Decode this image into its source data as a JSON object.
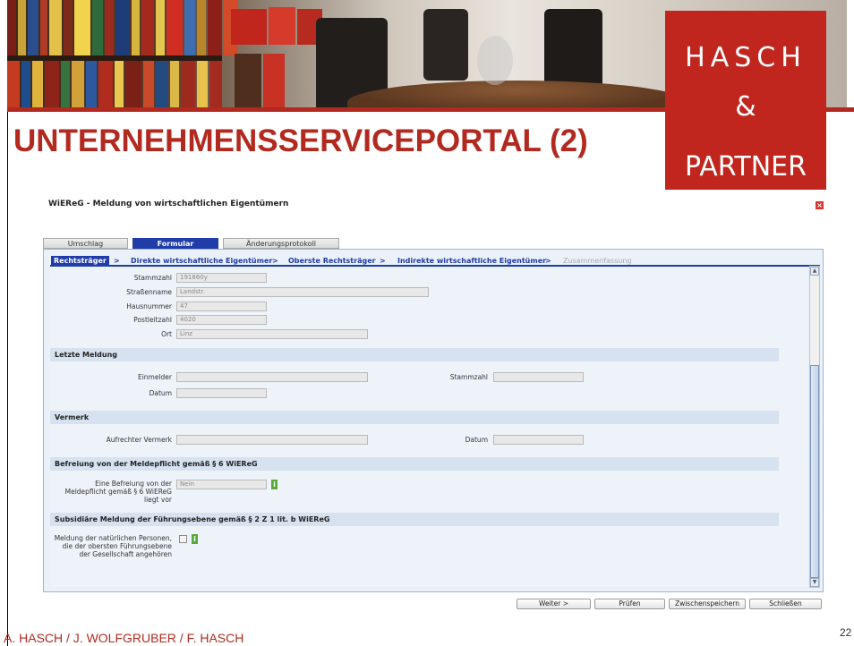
{
  "slide": {
    "title": "UNTERNEHMENSSERVICEPORTAL (2)",
    "footer": "A. HASCH / J. WOLFGRUBER / F. HASCH",
    "page_number": "22",
    "logo": {
      "line1": "HASCH",
      "line2": "&",
      "line3": "PARTNER"
    },
    "colors": {
      "brand_red": "#b22a1f",
      "nav_blue": "#1f3ca8"
    }
  },
  "app": {
    "title": "WiEReG - Meldung von wirtschaftlichen Eigentümern",
    "close_icon": "×",
    "tabs": [
      {
        "label": "Umschlag"
      },
      {
        "label": "Formular"
      },
      {
        "label": "Änderungsprotokoll"
      }
    ],
    "breadcrumb": [
      {
        "label": "Rechtsträger"
      },
      {
        "label": "Direkte wirtschaftliche Eigentümer"
      },
      {
        "label": "Oberste Rechtsträger"
      },
      {
        "label": "Indirekte wirtschaftliche Eigentümer"
      },
      {
        "label": "Zusammenfassung"
      }
    ],
    "breadcrumb_separator": ">",
    "address": {
      "stammzahl_label": "Stammzahl",
      "stammzahl_value": "191860y",
      "strassenname_label": "Straßenname",
      "strassenname_value": "Landstr.",
      "hausnummer_label": "Hausnummer",
      "hausnummer_value": "47",
      "postleitzahl_label": "Postleitzahl",
      "postleitzahl_value": "4020",
      "ort_label": "Ort",
      "ort_value": "Linz"
    },
    "letzte_meldung": {
      "heading": "Letzte Meldung",
      "einmelder_label": "Einmelder",
      "stammzahl_label": "Stammzahl",
      "datum_label": "Datum"
    },
    "vermerk": {
      "heading": "Vermerk",
      "aufrechter_label": "Aufrechter Vermerk",
      "datum_label": "Datum"
    },
    "befreiung": {
      "heading": "Befreiung von der Meldepflicht gemäß § 6 WiEReG",
      "label_line1": "Eine Befreiung von der",
      "label_line2": "Meldepflicht gemäß § 6 WiEReG",
      "label_line3": "liegt vor",
      "value": "Nein",
      "info_icon": "i"
    },
    "subsidiaer": {
      "heading": "Subsidiäre Meldung der Führungsebene gemäß § 2 Z 1 lit. b WiEReG",
      "label_line1": "Meldung der natürlichen Personen,",
      "label_line2": "die der obersten Führungsebene",
      "label_line3": "der Gesellschaft angehören",
      "info_icon": "i"
    },
    "buttons": {
      "weiter": "Weiter >",
      "pruefen": "Prüfen",
      "zwischenspeichern": "Zwischenspeichern",
      "schliessen": "Schließen"
    },
    "scroll_up_icon": "▲",
    "scroll_down_icon": "▼"
  }
}
